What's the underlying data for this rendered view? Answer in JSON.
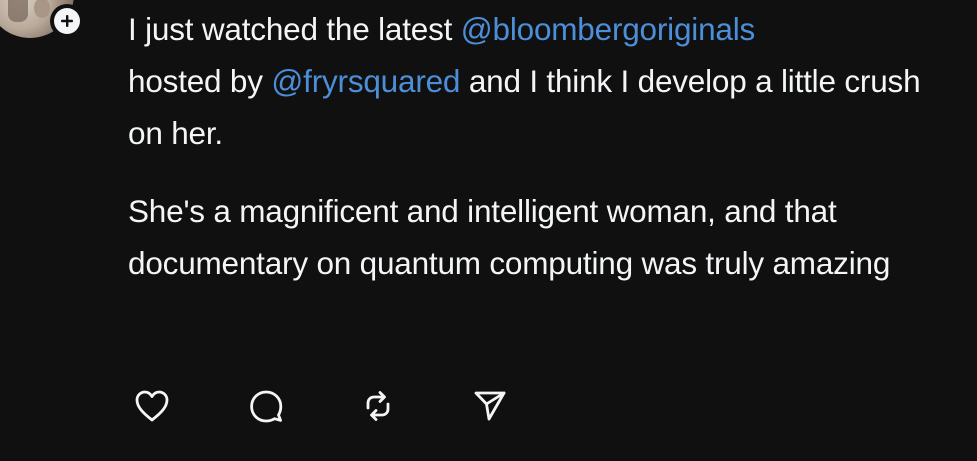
{
  "post": {
    "line1": {
      "before_mention1": "I just watched the latest ",
      "mention1": "@bloombergoriginals",
      "between": "hosted by ",
      "mention2": "@fryrsquared",
      "after_mention2": " and I think I develop a little crush on her."
    },
    "paragraph2": "She's a magnificent and intelligent woman, and that documentary on quantum computing was truly amazing"
  },
  "actions": {
    "icons": [
      "heart-icon",
      "comment-icon",
      "repost-icon",
      "share-icon"
    ]
  },
  "colors": {
    "background": "#101010",
    "text": "#f3f5f7",
    "mention": "#4c8fd8",
    "icon": "#f3f5f7"
  }
}
